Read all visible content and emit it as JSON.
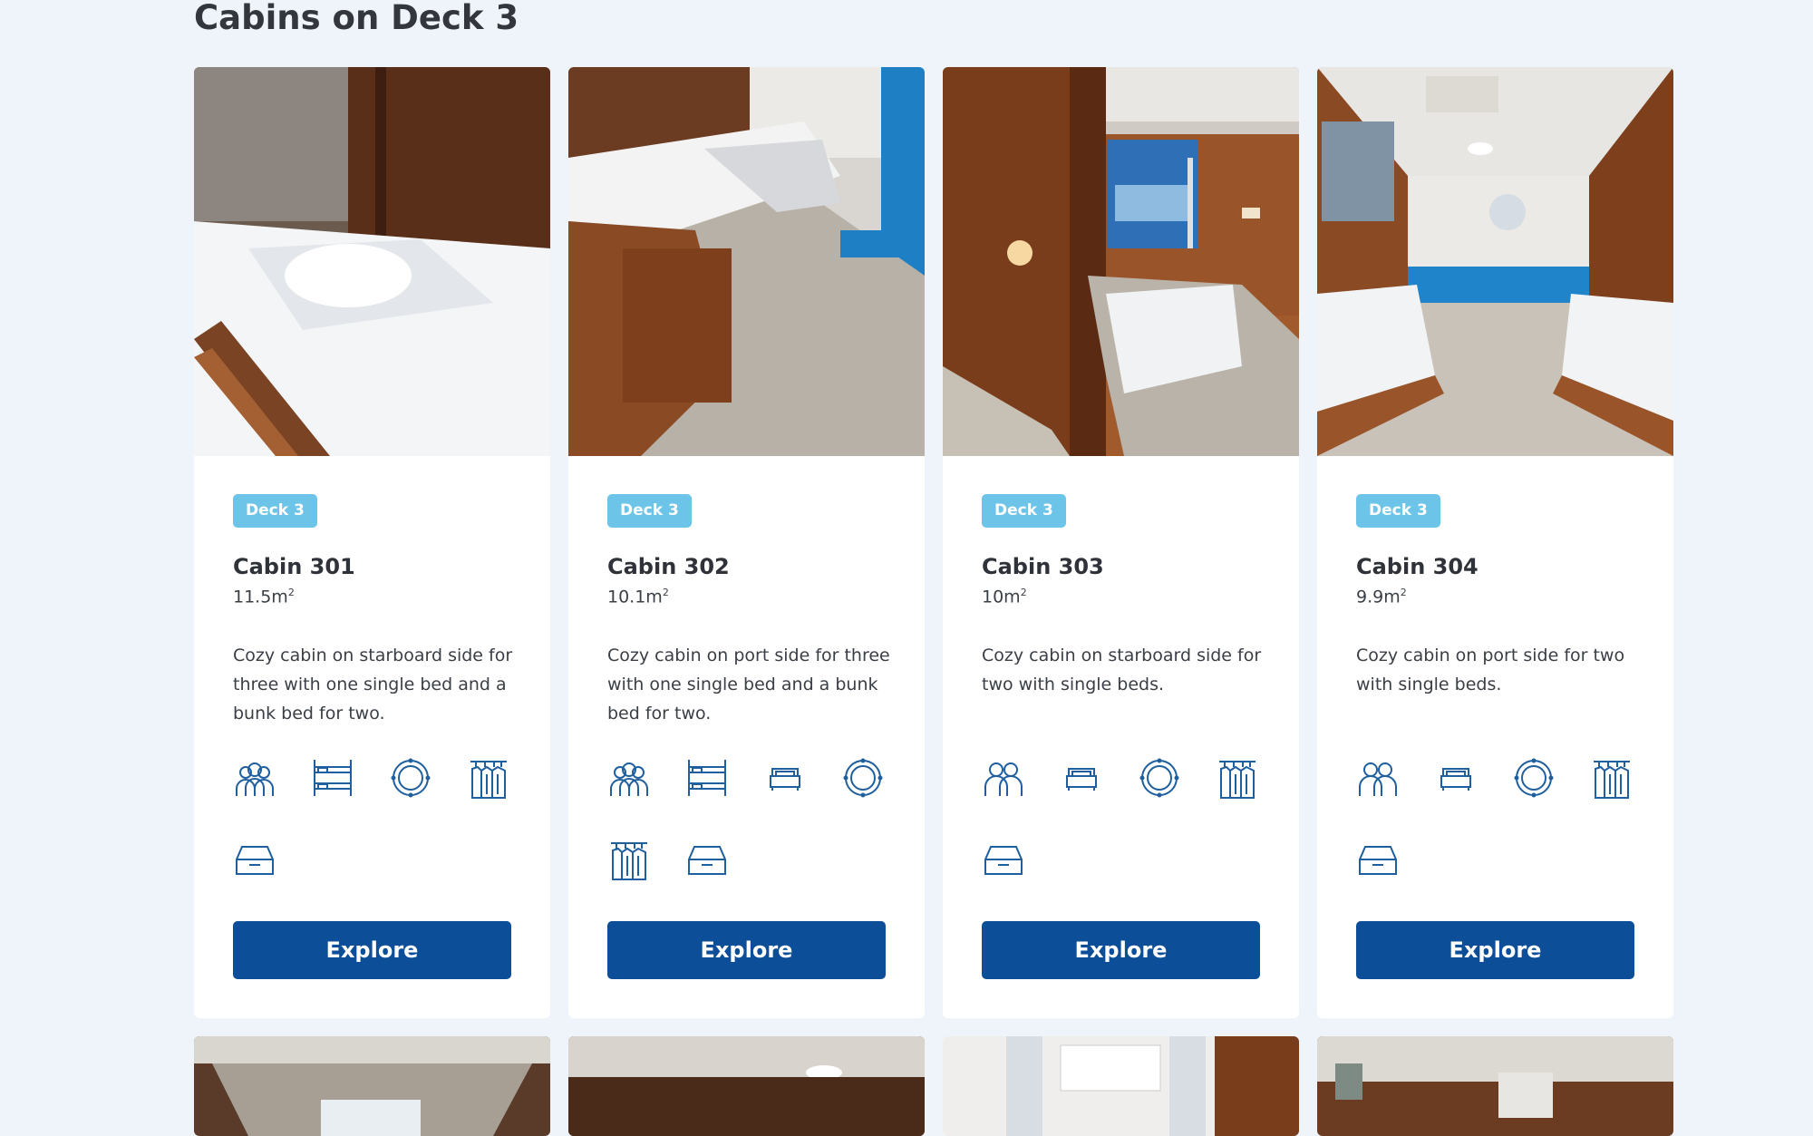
{
  "section": {
    "title": "Cabins on Deck 3"
  },
  "cabins": [
    {
      "badge": "Deck 3",
      "name": "Cabin 301",
      "size": "11.5m",
      "size_unit": "2",
      "description": "Cozy cabin on starboard side for three with one single bed and a bunk bed for two.",
      "amenities": [
        "three-guests-icon",
        "bunk-bed-icon",
        "porthole-icon",
        "wardrobe-icon",
        "storage-drawer-icon"
      ],
      "button": "Explore"
    },
    {
      "badge": "Deck 3",
      "name": "Cabin 302",
      "size": "10.1m",
      "size_unit": "2",
      "description": "Cozy cabin on port side for three with one single bed and a bunk bed for two.",
      "amenities": [
        "three-guests-icon",
        "bunk-bed-icon",
        "single-bed-icon",
        "porthole-icon",
        "wardrobe-icon",
        "storage-drawer-icon"
      ],
      "button": "Explore"
    },
    {
      "badge": "Deck 3",
      "name": "Cabin 303",
      "size": "10m",
      "size_unit": "2",
      "description": "Cozy cabin on starboard side for two with single beds.",
      "amenities": [
        "two-guests-icon",
        "single-bed-icon",
        "porthole-icon",
        "wardrobe-icon",
        "storage-drawer-icon"
      ],
      "button": "Explore"
    },
    {
      "badge": "Deck 3",
      "name": "Cabin 304",
      "size": "9.9m",
      "size_unit": "2",
      "description": "Cozy cabin on port side for two with single beds.",
      "amenities": [
        "two-guests-icon",
        "single-bed-icon",
        "porthole-icon",
        "wardrobe-icon",
        "storage-drawer-icon"
      ],
      "button": "Explore"
    }
  ],
  "colors": {
    "background": "#eef4fa",
    "badge": "#6cc4e8",
    "button": "#0c4e97",
    "icon": "#1f5f9e"
  }
}
